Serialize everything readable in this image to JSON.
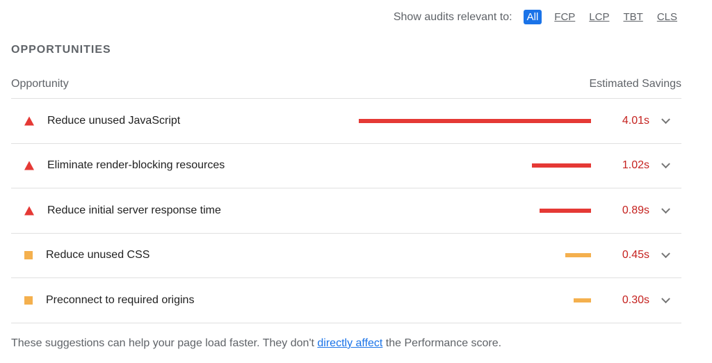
{
  "filter": {
    "label": "Show audits relevant to:",
    "chips": [
      {
        "label": "All",
        "active": true
      },
      {
        "label": "FCP",
        "active": false
      },
      {
        "label": "LCP",
        "active": false
      },
      {
        "label": "TBT",
        "active": false
      },
      {
        "label": "CLS",
        "active": false
      }
    ]
  },
  "section": {
    "title": "OPPORTUNITIES",
    "col_opportunity": "Opportunity",
    "col_savings": "Estimated Savings"
  },
  "audits": [
    {
      "title": "Reduce unused JavaScript",
      "savings": "4.01s",
      "status": "fail",
      "icon": "red-triangle-icon",
      "bar_fraction": 1.0
    },
    {
      "title": "Eliminate render-blocking resources",
      "savings": "1.02s",
      "status": "fail",
      "icon": "red-triangle-icon",
      "bar_fraction": 0.254
    },
    {
      "title": "Reduce initial server response time",
      "savings": "0.89s",
      "status": "fail",
      "icon": "red-triangle-icon",
      "bar_fraction": 0.222
    },
    {
      "title": "Reduce unused CSS",
      "savings": "0.45s",
      "status": "average",
      "icon": "orange-square-icon",
      "bar_fraction": 0.112
    },
    {
      "title": "Preconnect to required origins",
      "savings": "0.30s",
      "status": "average",
      "icon": "orange-square-icon",
      "bar_fraction": 0.075
    }
  ],
  "footnote": {
    "before": "These suggestions can help your page load faster. They don't ",
    "link": "directly affect",
    "after": " the Performance score."
  },
  "colors": {
    "fail": "#e53935",
    "average": "#f4b04e",
    "accent": "#1a73e8"
  }
}
